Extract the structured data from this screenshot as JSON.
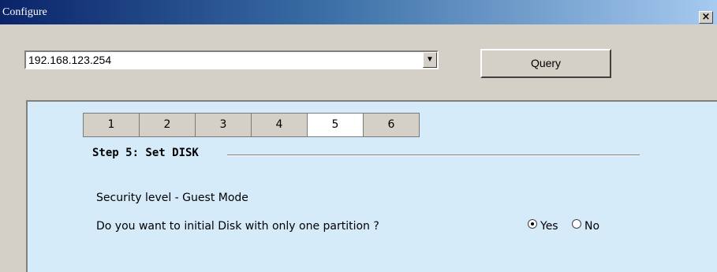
{
  "window": {
    "title": "Configure",
    "close_glyph": "×"
  },
  "address_combo": {
    "value": "192.168.123.254",
    "arrow_glyph": "▼"
  },
  "query_button": {
    "label": "Query"
  },
  "wizard": {
    "tabs": [
      {
        "label": "1",
        "active": false
      },
      {
        "label": "2",
        "active": false
      },
      {
        "label": "3",
        "active": false
      },
      {
        "label": "4",
        "active": false
      },
      {
        "label": "5",
        "active": true
      },
      {
        "label": "6",
        "active": false
      }
    ],
    "step_title": "Step 5: Set DISK",
    "security_level": "Security level - Guest Mode",
    "question": "Do you want to initial Disk with only one partition ?",
    "options": [
      {
        "label": "Yes",
        "selected": true
      },
      {
        "label": "No",
        "selected": false
      }
    ]
  }
}
